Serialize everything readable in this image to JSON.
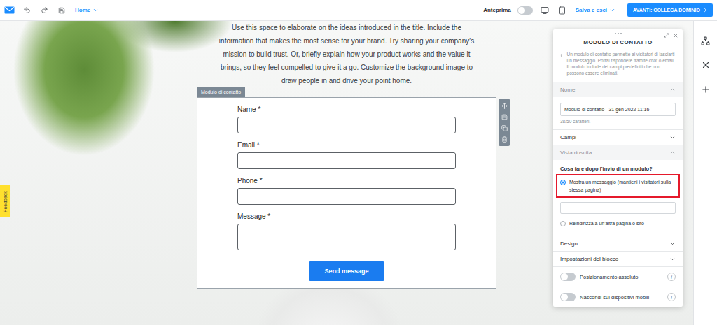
{
  "topbar": {
    "page_menu": "Home",
    "preview": {
      "label": "Anteprima",
      "on": false
    },
    "save_menu": "Salva e esci",
    "next_button": "AVANTI: COLLEGA DOMINIO"
  },
  "feedback_tab": "Feedback",
  "paragraph": "Use this space to elaborate on the ideas introduced in the title. Include the information that makes the most sense for your brand. Try sharing your company's mission to build trust. Or, briefly explain how your product works and the value it brings, so they feel compelled to give it a go. Customize the background image to draw people in and drive your point home.",
  "contact_form": {
    "tag": "Modulo di contatto",
    "fields": [
      {
        "label": "Name *",
        "kind": "input"
      },
      {
        "label": "Email *",
        "kind": "input"
      },
      {
        "label": "Phone *",
        "kind": "input"
      },
      {
        "label": "Message *",
        "kind": "textarea"
      }
    ],
    "submit": "Send message"
  },
  "panel": {
    "title": "MODULO DI CONTATTO",
    "info": "Un modulo di contatto permette ai visitatori di lasciarti un messaggio. Potrai rispondere tramite chat o email. Il modulo include dei campi predefiniti che non possono essere eliminati.",
    "sections": [
      {
        "title": "Nome",
        "expanded": true,
        "kind": "name"
      },
      {
        "title": "Campi",
        "expanded": false,
        "kind": "plain"
      },
      {
        "title": "Vista riuscita",
        "expanded": true,
        "kind": "success"
      },
      {
        "title": "Design",
        "expanded": false,
        "kind": "plain"
      },
      {
        "title": "Impostazioni del blocco",
        "expanded": false,
        "kind": "plain"
      }
    ],
    "name_field": {
      "value": "Modulo di contatto - 31 gen 2022 11:16",
      "counter": "38/50 caratteri."
    },
    "success_view": {
      "question": "Cosa fare dopo l'invio di un modulo?",
      "message": "",
      "options": [
        {
          "label": "Mostra un messaggio (mantieni i visitatori sulla stessa pagina)",
          "selected": true,
          "highlighted": true
        },
        {
          "label": "Reindirizza a un'altra pagina o sito",
          "selected": false,
          "highlighted": false
        }
      ]
    },
    "toggles": [
      {
        "label": "Posizionamento assoluto",
        "on": false,
        "info": "i"
      },
      {
        "label": "Nascondi sui dispositivi mobili",
        "on": false,
        "info": "i"
      }
    ]
  }
}
